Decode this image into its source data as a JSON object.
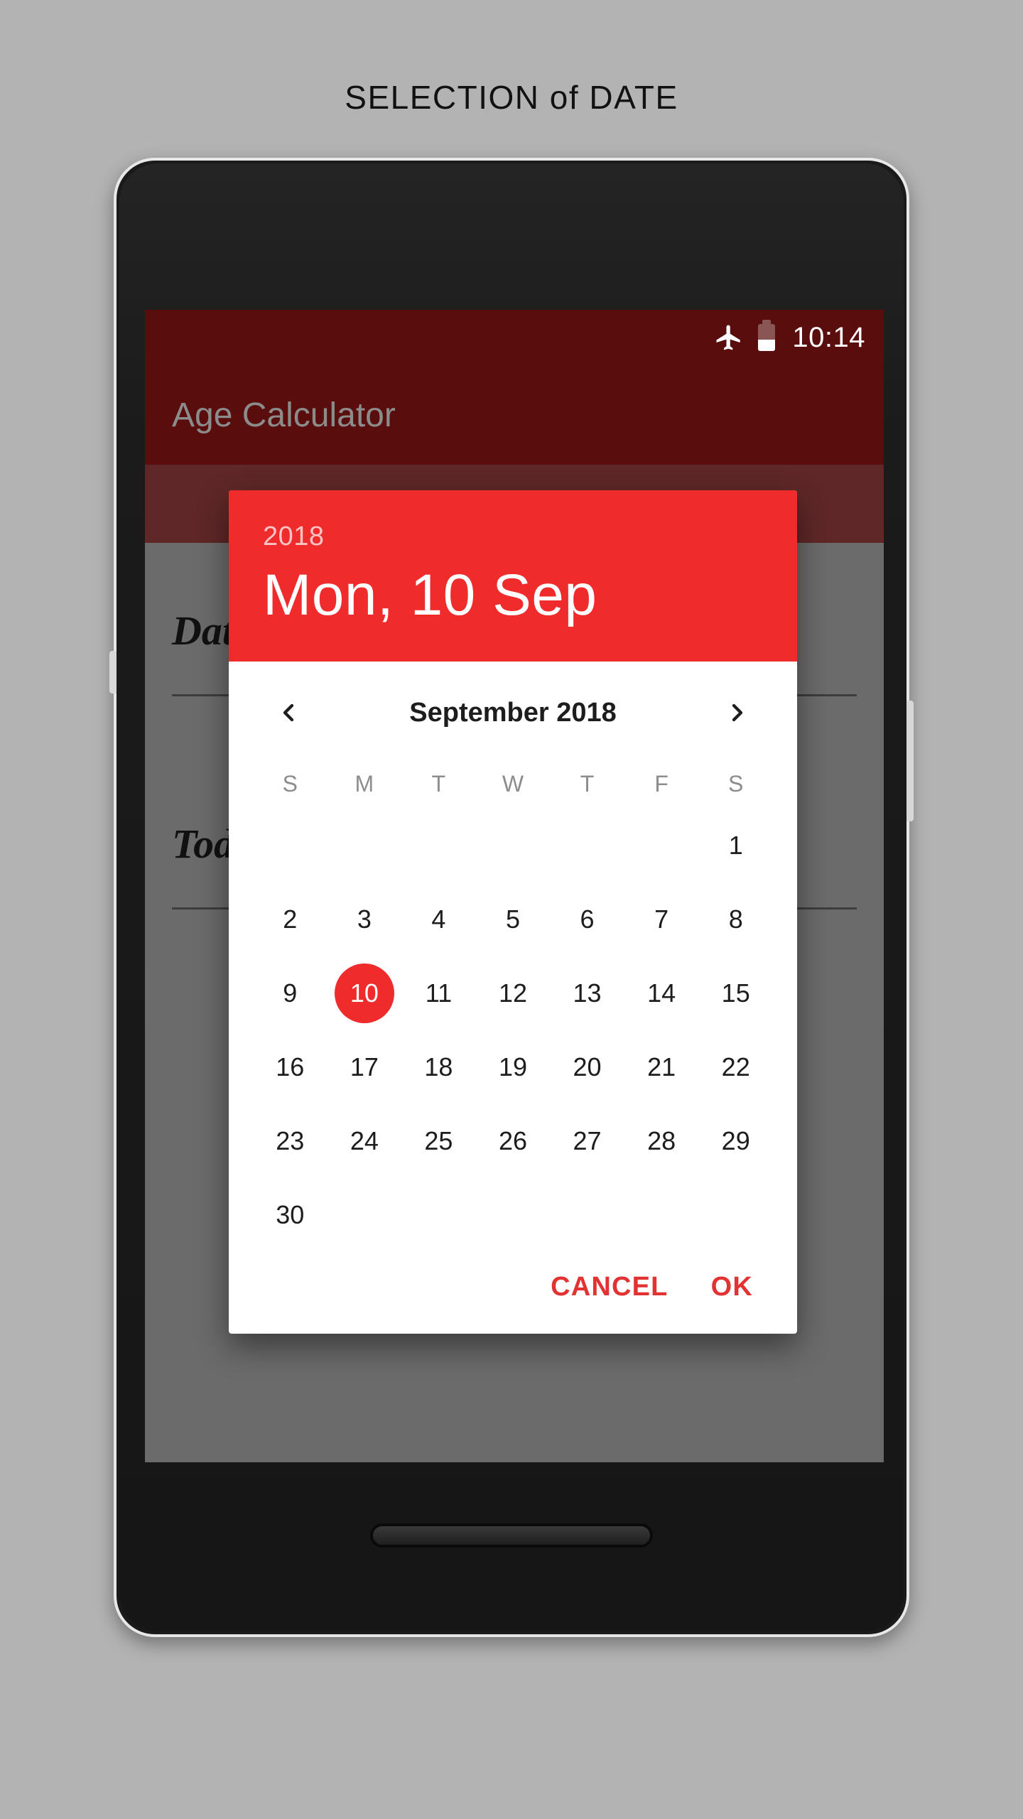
{
  "page": {
    "title": "SELECTION of DATE",
    "background_color": "#b3b3b3"
  },
  "phone": {
    "status_bar": {
      "time": "10:14",
      "airplane_icon": "airplane-mode-icon",
      "battery_icon": "battery-icon",
      "battery_level_pct": 42,
      "background_color": "#5a0d0d"
    },
    "app_bar": {
      "title": "Age Calculator",
      "background_color": "#5a0d0d",
      "title_color": "#8c8c8c"
    },
    "app_body": {
      "fields": [
        {
          "label": "Date of Birth"
        },
        {
          "label": "Today's Date"
        }
      ],
      "primary_button_label": "",
      "primary_button_color": "#8d1212",
      "scrim_color": "#6b6b6b"
    }
  },
  "date_picker": {
    "accent_color": "#ef2b2b",
    "header": {
      "year": "2018",
      "date": "Mon, 10 Sep"
    },
    "nav": {
      "prev_icon": "chevron-left-icon",
      "next_icon": "chevron-right-icon",
      "month_label": "September 2018"
    },
    "weekdays": [
      "S",
      "M",
      "T",
      "W",
      "T",
      "F",
      "S"
    ],
    "weeks": [
      [
        "",
        "",
        "",
        "",
        "",
        "",
        "1"
      ],
      [
        "2",
        "3",
        "4",
        "5",
        "6",
        "7",
        "8"
      ],
      [
        "9",
        "10",
        "11",
        "12",
        "13",
        "14",
        "15"
      ],
      [
        "16",
        "17",
        "18",
        "19",
        "20",
        "21",
        "22"
      ],
      [
        "23",
        "24",
        "25",
        "26",
        "27",
        "28",
        "29"
      ],
      [
        "30",
        "",
        "",
        "",
        "",
        "",
        ""
      ]
    ],
    "selected_day": "10",
    "actions": {
      "cancel_label": "CANCEL",
      "ok_label": "OK"
    }
  }
}
